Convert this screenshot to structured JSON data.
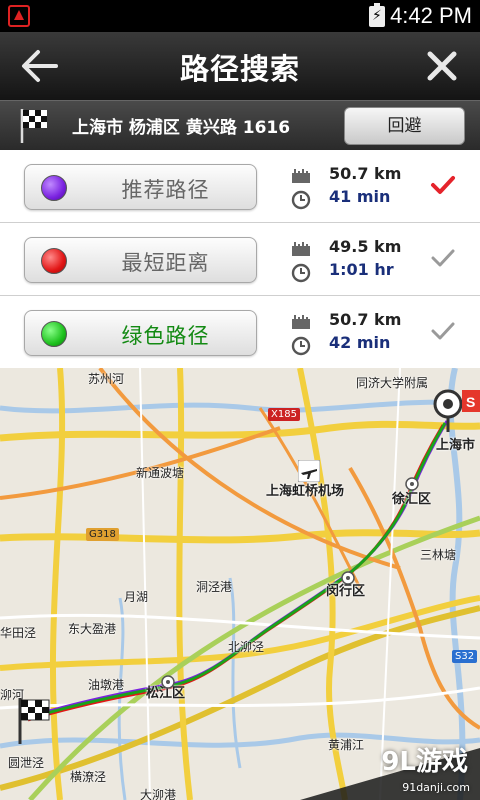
{
  "status_bar": {
    "time": "4:42 PM"
  },
  "header": {
    "title": "路径搜索"
  },
  "destination": {
    "address": "上海市 杨浦区 黄兴路 1616",
    "avoid_label": "回避"
  },
  "routes": [
    {
      "label": "推荐路径",
      "color": "#7a22e0",
      "distance": "50.7 km",
      "duration": "41 min",
      "selected": true
    },
    {
      "label": "最短距离",
      "color": "#e21616",
      "distance": "49.5 km",
      "duration": "1:01 hr",
      "selected": false
    },
    {
      "label": "绿色路径",
      "color": "#1fc21f",
      "distance": "50.7 km",
      "duration": "42 min",
      "selected": false
    }
  ],
  "colors": {
    "check_selected": "#e5232b",
    "check_unselected": "#9a9a9a",
    "route_line": "#1aa31a"
  },
  "map": {
    "labels": {
      "suzhou_river": "苏州河",
      "tongji": "同济大学附属",
      "xinjing": "新通波塘",
      "hongqiao": "上海虹桥机场",
      "xuhui": "徐汇区",
      "shanghai": "上海市",
      "sanlin": "三林塘",
      "dongjing": "洞泾港",
      "yuehu": "月湖",
      "minhang": "闵行区",
      "dongdaying": "东大盈港",
      "huating": "华田泾",
      "beiqiao": "北泖泾",
      "youdun": "油墩港",
      "songjiang": "松江区",
      "jinghe": "泖河",
      "shuangyang": "圆泄泾",
      "zhenze": "横潦泾",
      "dazhen": "大泖港",
      "huangpu": "黄浦江"
    },
    "road_signs": {
      "x185": "X185",
      "g318": "G318",
      "s32": "S32"
    },
    "watermark": "9L游戏",
    "watermark_sub": "91danji.com"
  }
}
